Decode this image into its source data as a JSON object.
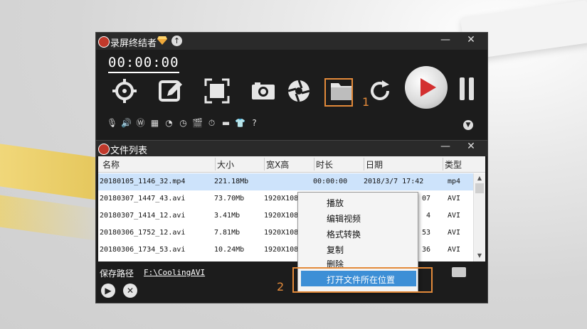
{
  "recorder": {
    "title": "录屏终结者",
    "timer": "00:00:00",
    "controls": {
      "minimize": "—",
      "close": "✕"
    },
    "tools": [
      {
        "name": "target-area"
      },
      {
        "name": "edit"
      },
      {
        "name": "fullscreen"
      },
      {
        "name": "camera"
      },
      {
        "name": "aperture"
      },
      {
        "name": "open-folder"
      }
    ],
    "annotation_1": "1"
  },
  "filelist": {
    "title": "文件列表",
    "controls": {
      "minimize": "—",
      "close": "✕"
    },
    "columns": [
      "名称",
      "大小",
      "宽X高",
      "时长",
      "日期",
      "类型"
    ],
    "rows": [
      {
        "name": "20180105_1146_32.mp4",
        "size": "221.18Mb",
        "dims": "",
        "duration": "00:00:00",
        "date": "2018/3/7 17:42",
        "type": "mp4"
      },
      {
        "name": "20180307_1447_43.avi",
        "size": "73.70Mb",
        "dims": "1920X108",
        "duration": "",
        "date": "07",
        "type": "AVI"
      },
      {
        "name": "20180307_1414_12.avi",
        "size": "3.41Mb",
        "dims": "1920X108",
        "duration": "",
        "date": "4",
        "type": "AVI"
      },
      {
        "name": "20180306_1752_12.avi",
        "size": "7.81Mb",
        "dims": "1920X108",
        "duration": "",
        "date": "53",
        "type": "AVI"
      },
      {
        "name": "20180306_1734_53.avi",
        "size": "10.24Mb",
        "dims": "1920X108",
        "duration": "",
        "date": "36",
        "type": "AVI"
      }
    ],
    "save_path_label": "保存路径",
    "save_path_value": "F:\\CoolingAVI"
  },
  "context_menu": {
    "items": [
      "播放",
      "编辑视频",
      "格式转换",
      "复制",
      "删除",
      "打开文件所在位置"
    ],
    "active_index": 5
  },
  "annotation_2": "2",
  "colors": {
    "highlight": "#e38a3a",
    "record": "#d32f2f",
    "selection": "#cde3fb",
    "menu_active": "#3d8fd6"
  }
}
